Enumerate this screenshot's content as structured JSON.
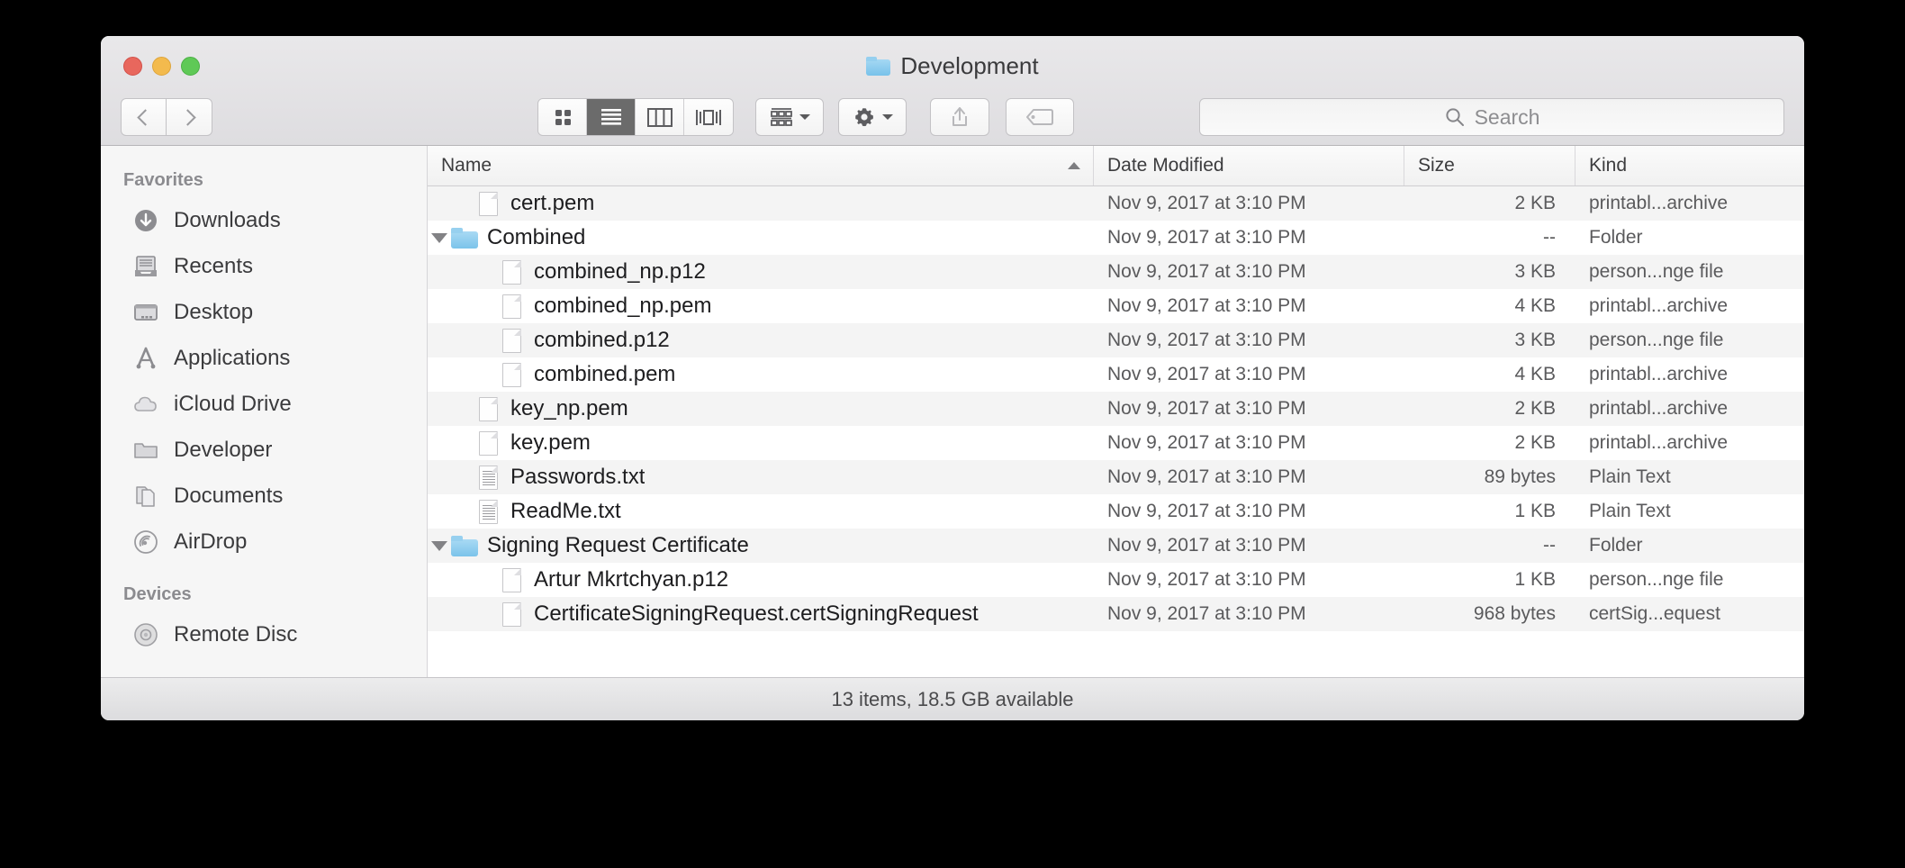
{
  "window": {
    "title": "Development",
    "title_icon": "folder-icon",
    "traffic_lights": [
      {
        "name": "close",
        "color": "#e8675d"
      },
      {
        "name": "minimize",
        "color": "#f3ba4d"
      },
      {
        "name": "maximize",
        "color": "#5fc956"
      }
    ]
  },
  "toolbar": {
    "back_icon": "chevron-left-icon",
    "forward_icon": "chevron-right-icon",
    "view_modes": [
      {
        "name": "icon-view",
        "icon": "grid-icon",
        "selected": false
      },
      {
        "name": "list-view",
        "icon": "list-icon",
        "selected": true
      },
      {
        "name": "column-view",
        "icon": "columns-icon",
        "selected": false
      },
      {
        "name": "coverflow-view",
        "icon": "coverflow-icon",
        "selected": false
      }
    ],
    "group_by": {
      "name": "group-by-button",
      "icon": "grid-rows-icon"
    },
    "action": {
      "name": "action-button",
      "icon": "gear-icon"
    },
    "share": {
      "name": "share-button",
      "icon": "share-icon",
      "enabled": false
    },
    "tags": {
      "name": "tags-button",
      "icon": "tag-icon",
      "enabled": false
    }
  },
  "search": {
    "placeholder": "Search",
    "icon": "search-icon",
    "value": ""
  },
  "sidebar": {
    "sections": [
      {
        "header": "Favorites",
        "items": [
          {
            "label": "Downloads",
            "icon": "downloads-icon"
          },
          {
            "label": "Recents",
            "icon": "recents-icon"
          },
          {
            "label": "Desktop",
            "icon": "desktop-icon"
          },
          {
            "label": "Applications",
            "icon": "applications-icon"
          },
          {
            "label": "iCloud Drive",
            "icon": "icloud-icon"
          },
          {
            "label": "Developer",
            "icon": "folder-icon"
          },
          {
            "label": "Documents",
            "icon": "documents-icon"
          },
          {
            "label": "AirDrop",
            "icon": "airdrop-icon"
          }
        ]
      },
      {
        "header": "Devices",
        "items": [
          {
            "label": "Remote Disc",
            "icon": "disc-icon"
          }
        ]
      }
    ]
  },
  "filelist": {
    "columns": [
      {
        "label": "Name",
        "sorted": "asc"
      },
      {
        "label": "Date Modified",
        "sorted": null
      },
      {
        "label": "Size",
        "sorted": null
      },
      {
        "label": "Kind",
        "sorted": null
      }
    ],
    "rows": [
      {
        "name": "cert.pem",
        "date": "Nov 9, 2017 at 3:10 PM",
        "size": "2 KB",
        "kind": "printabl...archive",
        "icon": "document-icon",
        "indent": 1,
        "expandable": false
      },
      {
        "name": "Combined",
        "date": "Nov 9, 2017 at 3:10 PM",
        "size": "--",
        "kind": "Folder",
        "icon": "folder-icon",
        "indent": 0,
        "expandable": true,
        "expanded": true
      },
      {
        "name": "combined_np.p12",
        "date": "Nov 9, 2017 at 3:10 PM",
        "size": "3 KB",
        "kind": "person...nge file",
        "icon": "document-icon",
        "indent": 2,
        "expandable": false
      },
      {
        "name": "combined_np.pem",
        "date": "Nov 9, 2017 at 3:10 PM",
        "size": "4 KB",
        "kind": "printabl...archive",
        "icon": "document-icon",
        "indent": 2,
        "expandable": false
      },
      {
        "name": "combined.p12",
        "date": "Nov 9, 2017 at 3:10 PM",
        "size": "3 KB",
        "kind": "person...nge file",
        "icon": "document-icon",
        "indent": 2,
        "expandable": false
      },
      {
        "name": "combined.pem",
        "date": "Nov 9, 2017 at 3:10 PM",
        "size": "4 KB",
        "kind": "printabl...archive",
        "icon": "document-icon",
        "indent": 2,
        "expandable": false
      },
      {
        "name": "key_np.pem",
        "date": "Nov 9, 2017 at 3:10 PM",
        "size": "2 KB",
        "kind": "printabl...archive",
        "icon": "document-icon",
        "indent": 1,
        "expandable": false
      },
      {
        "name": "key.pem",
        "date": "Nov 9, 2017 at 3:10 PM",
        "size": "2 KB",
        "kind": "printabl...archive",
        "icon": "document-icon",
        "indent": 1,
        "expandable": false
      },
      {
        "name": "Passwords.txt",
        "date": "Nov 9, 2017 at 3:10 PM",
        "size": "89 bytes",
        "kind": "Plain Text",
        "icon": "text-document-icon",
        "indent": 1,
        "expandable": false
      },
      {
        "name": "ReadMe.txt",
        "date": "Nov 9, 2017 at 3:10 PM",
        "size": "1 KB",
        "kind": "Plain Text",
        "icon": "text-document-icon",
        "indent": 1,
        "expandable": false
      },
      {
        "name": "Signing Request Certificate",
        "date": "Nov 9, 2017 at 3:10 PM",
        "size": "--",
        "kind": "Folder",
        "icon": "folder-icon",
        "indent": 0,
        "expandable": true,
        "expanded": true
      },
      {
        "name": "Artur Mkrtchyan.p12",
        "date": "Nov 9, 2017 at 3:10 PM",
        "size": "1 KB",
        "kind": "person...nge file",
        "icon": "document-icon",
        "indent": 2,
        "expandable": false
      },
      {
        "name": "CertificateSigningRequest.certSigningRequest",
        "date": "Nov 9, 2017 at 3:10 PM",
        "size": "968 bytes",
        "kind": "certSig...equest",
        "icon": "document-icon",
        "indent": 2,
        "expandable": false
      }
    ]
  },
  "statusbar": {
    "text": "13 items, 18.5 GB available"
  }
}
